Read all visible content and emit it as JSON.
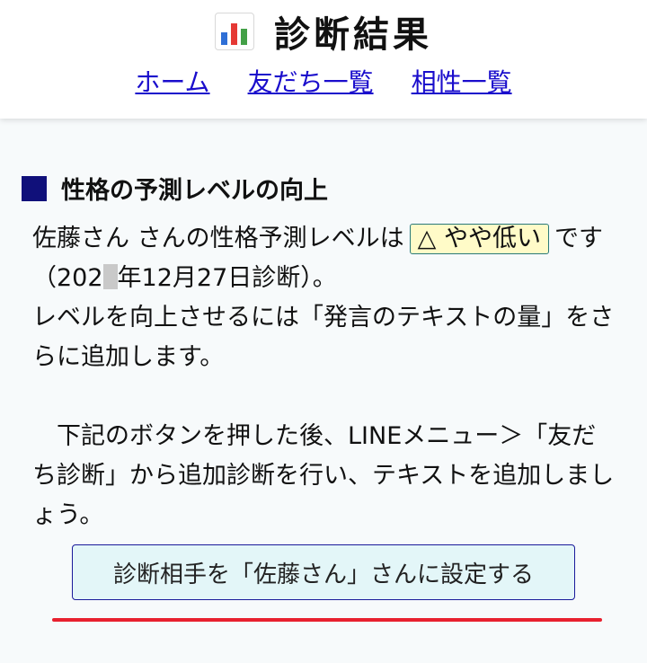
{
  "header": {
    "title_icon": "bar-chart-icon",
    "title": "診断結果",
    "nav": {
      "home": "ホーム",
      "friends": "友だち一覧",
      "compat": "相性一覧"
    }
  },
  "section": {
    "heading": "性格の予測レベルの向上"
  },
  "body": {
    "line1_prefix": "佐藤さん さんの性格予測レベルは",
    "level_label": "△ やや低い",
    "line1_suffix": "で",
    "date_prefix": "す（202",
    "date_suffix": "年12月27日診断）。",
    "line3": " レベルを向上させるには「発言のテキストの量」をさらに追加します。",
    "para2": "　下記のボタンを押した後、LINEメニュー＞「友だち診断」から追加診断を行い、テキストを追加しましょう。"
  },
  "button": {
    "set_label": "診断相手を「佐藤さん」さんに設定する"
  },
  "colors": {
    "link": "#1a0dcc",
    "heading_square": "#10107a",
    "badge_bg": "#fffbc8",
    "button_bg": "#e3f6f8",
    "red_line": "#e8202e"
  }
}
